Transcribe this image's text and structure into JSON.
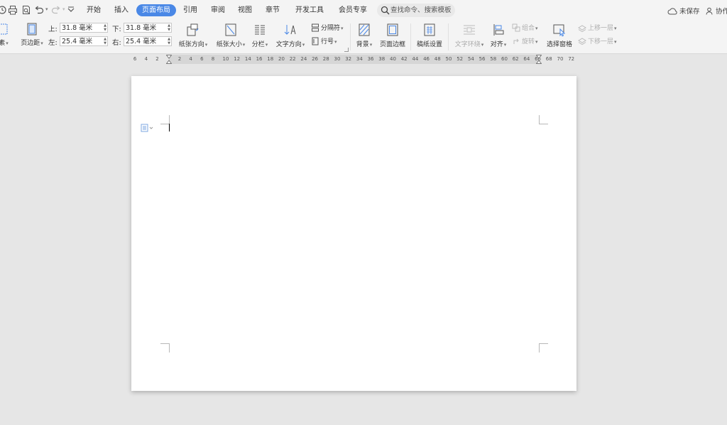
{
  "quick_access": {
    "icons": [
      "undo-history-icon",
      "print-icon",
      "print-preview-icon",
      "undo-icon",
      "redo-icon",
      "customize-icon"
    ]
  },
  "menu": {
    "tabs": [
      {
        "label": "开始",
        "active": false
      },
      {
        "label": "插入",
        "active": false
      },
      {
        "label": "页面布局",
        "active": true
      },
      {
        "label": "引用",
        "active": false
      },
      {
        "label": "审阅",
        "active": false
      },
      {
        "label": "视图",
        "active": false
      },
      {
        "label": "章节",
        "active": false
      },
      {
        "label": "开发工具",
        "active": false
      },
      {
        "label": "会员专享",
        "active": false
      }
    ],
    "search_placeholder": "查找命令、搜索模板",
    "unsaved": "未保存",
    "collab": "协作",
    "accent": "#4a88e6"
  },
  "ribbon": {
    "theme_partial": "素",
    "margins_label": "页边距",
    "top_label": "上:",
    "top_value": "31.8 毫米",
    "bottom_label": "下:",
    "bottom_value": "31.8 毫米",
    "left_label": "左:",
    "left_value": "25.4 毫米",
    "right_label": "右:",
    "right_value": "25.4 毫米",
    "orientation": "纸张方向",
    "size": "纸张大小",
    "columns": "分栏",
    "text_direction": "文字方向",
    "breaks": "分隔符",
    "line_numbers": "行号",
    "background": "背景",
    "page_border": "页面边框",
    "grid_paper": "稿纸设置",
    "wrap_text": "文字环绕",
    "align": "对齐",
    "group": "组合",
    "rotate": "旋转",
    "selection_pane": "选择窗格",
    "bring_forward": "上移一层",
    "send_backward": "下移一层"
  },
  "ruler": {
    "numbers": [
      "6",
      "4",
      "2",
      "2",
      "4",
      "6",
      "8",
      "10",
      "12",
      "14",
      "16",
      "18",
      "20",
      "22",
      "24",
      "26",
      "28",
      "30",
      "32",
      "34",
      "36",
      "38",
      "40",
      "42",
      "44",
      "46",
      "48",
      "50",
      "52",
      "54",
      "56",
      "58",
      "60",
      "62",
      "64",
      "66",
      "68",
      "70",
      "72"
    ]
  }
}
